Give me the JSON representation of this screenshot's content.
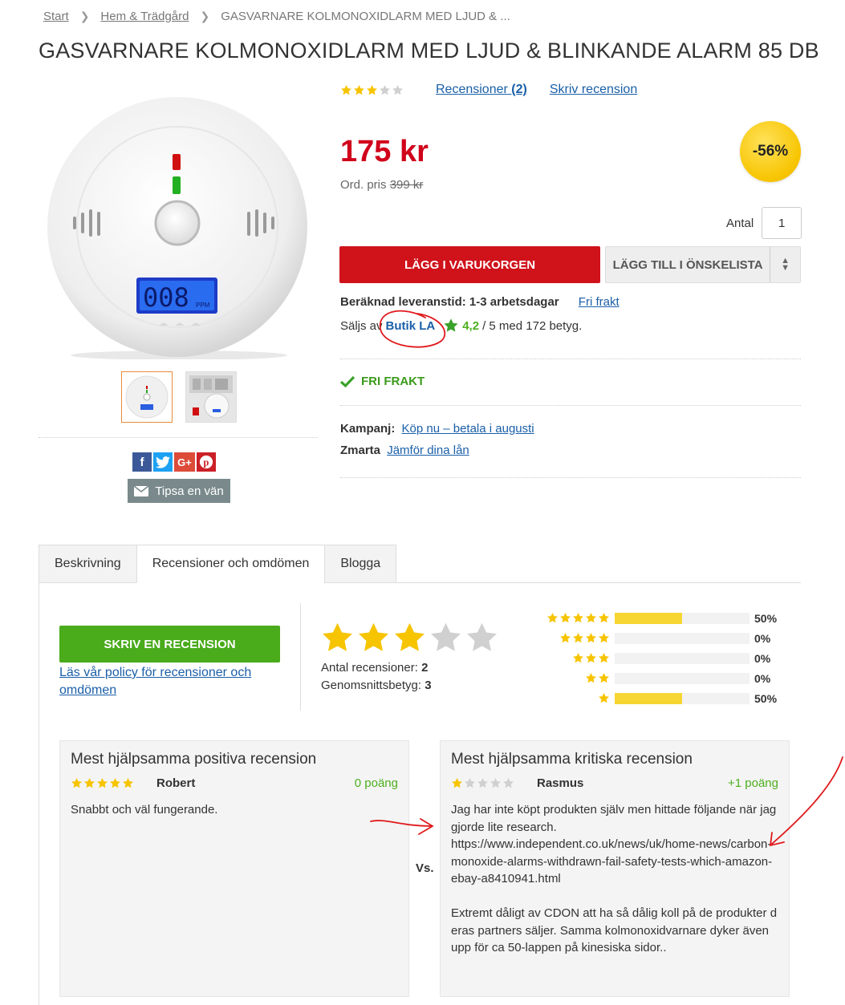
{
  "breadcrumb": {
    "home": "Start",
    "category": "Hem & Trädgård",
    "current": "GASVARNARE KOLMONOXIDLARM MED LJUD & ..."
  },
  "product": {
    "title": "GASVARNARE KOLMONOXIDLARM MED LJUD & BLINKANDE ALARM 85 DB",
    "rating": 3,
    "rating_max": 5,
    "reviews_link": "Recensioner",
    "reviews_count": "(2)",
    "write_review_link": "Skriv recension",
    "price": "175 kr",
    "orig_label": "Ord. pris",
    "orig_price": "399 kr",
    "discount": "-56%",
    "display_reading": "008",
    "display_unit": "PPM"
  },
  "purchase": {
    "qty_label": "Antal",
    "qty_value": "1",
    "add_to_cart": "LÄGG I VARUKORGEN",
    "add_to_wishlist": "LÄGG TILL I ÖNSKELISTA"
  },
  "delivery": {
    "label": "Beräknad leveranstid:",
    "value": "1-3 arbetsdagar",
    "free_shipping_link": "Fri frakt"
  },
  "seller": {
    "label": "Säljs av",
    "name": "Butik LA",
    "score": "4,2",
    "rest": "/ 5 med 172 betyg."
  },
  "free_shipping_badge": "FRI FRAKT",
  "campaign": {
    "label": "Kampanj:",
    "link": "Köp nu – betala i augusti"
  },
  "zmarta": {
    "label": "Zmarta",
    "link": "Jämför dina lån"
  },
  "share": {
    "tip_friend": "Tipsa en vän",
    "icons": [
      "facebook-icon",
      "twitter-icon",
      "googleplus-icon",
      "pinterest-icon"
    ]
  },
  "tabs": [
    "Beskrivning",
    "Recensioner och omdömen",
    "Blogga"
  ],
  "reviews": {
    "write_button": "SKRIV EN RECENSION",
    "policy_link": "Läs vår policy för recensioner och omdömen",
    "avg_stars": 3,
    "count_label": "Antal recensioner:",
    "count_value": "2",
    "avg_label": "Genomsnittsbetyg:",
    "avg_value": "3",
    "distribution": [
      {
        "stars": 5,
        "fraction": 0.5,
        "pct": "50%"
      },
      {
        "stars": 4,
        "fraction": 0.0,
        "pct": "0%"
      },
      {
        "stars": 3,
        "fraction": 0.0,
        "pct": "0%"
      },
      {
        "stars": 2,
        "fraction": 0.0,
        "pct": "0%"
      },
      {
        "stars": 1,
        "fraction": 0.5,
        "pct": "50%"
      }
    ],
    "vs": "Vs.",
    "positive": {
      "heading": "Mest hjälpsamma positiva recension",
      "stars": 5,
      "author": "Robert",
      "points": "0 poäng",
      "text": "Snabbt och väl fungerande."
    },
    "critical": {
      "heading": "Mest hjälpsamma kritiska recension",
      "stars": 1,
      "author": "Rasmus",
      "points": "+1 poäng",
      "text": "Jag har inte köpt produkten själv men hittade följande när jag gjorde lite research.\nhttps://www.independent.co.uk/news/uk/home-news/carbon-monoxide-alarms-withdrawn-fail-safety-tests-which-amazon-ebay-a8410941.html\n\nExtremt dåligt av CDON att ha så dålig koll på de produkter deras partners säljer. Samma kolmonoxidvarnare dyker även upp för ca 50-lappen på kinesiska sidor.."
    }
  },
  "colors": {
    "price_red": "#d0021b",
    "cart_red": "#d0121b",
    "review_green": "#4aab1b",
    "star_yellow": "#f7c400",
    "badge_yellow": "#f7c400",
    "link_blue": "#1a5fa8",
    "annotation_red": "#e0191c"
  }
}
